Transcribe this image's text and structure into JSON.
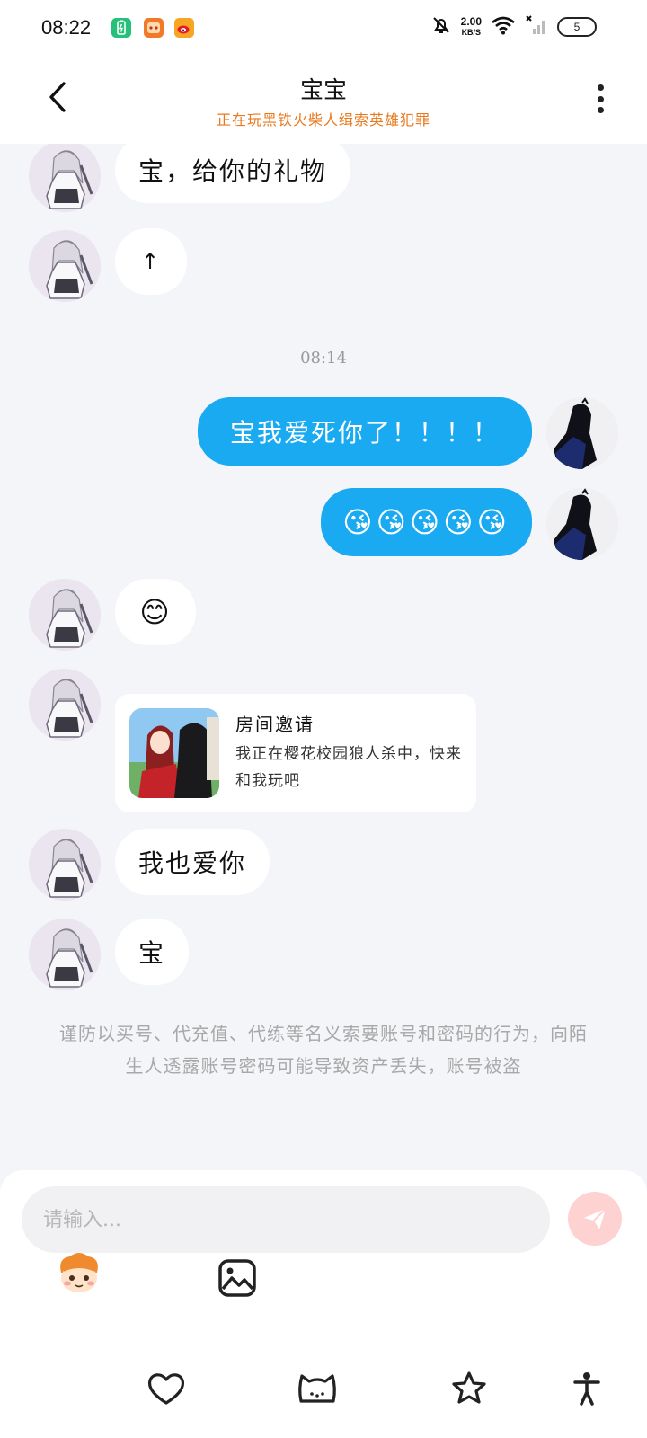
{
  "status_bar": {
    "time": "08:22",
    "net_speed_value": "2.00",
    "net_speed_unit": "KB/S",
    "battery": "5",
    "icons": [
      "battery-saver-app-icon",
      "game-app-icon",
      "weibo-app-icon",
      "mute-bell-icon",
      "wifi-icon",
      "cellular-icon",
      "battery-icon"
    ]
  },
  "header": {
    "title": "宝宝",
    "status": "正在玩黑铁火柴人缉索英雄犯罪"
  },
  "messages": [
    {
      "side": "other",
      "text": "宝，给你的礼物"
    },
    {
      "side": "other",
      "text": "↑"
    },
    {
      "side": "time",
      "text": "08:14"
    },
    {
      "side": "self",
      "text": "宝我爱死你了！！！！"
    },
    {
      "side": "self",
      "text": "😘😘😘😘😘"
    },
    {
      "side": "other",
      "text": "😊"
    },
    {
      "side": "other",
      "type": "invite",
      "title": "房间邀请",
      "desc": "我正在樱花校园狼人杀中，快来和我玩吧"
    },
    {
      "side": "other",
      "text": "我也爱你"
    },
    {
      "side": "other",
      "text": "宝"
    }
  ],
  "warning": "谨防以买号、代充值、代练等名义索要账号和密码的行为，向陌生人透露账号密码可能导致资产丢失，账号被盗",
  "input": {
    "placeholder": "请输入..."
  },
  "toolbar": {
    "icons": [
      "emoji-sticker-icon",
      "image-icon"
    ]
  },
  "bottom_nav": {
    "icons": [
      "heart-icon",
      "cat-face-icon",
      "star-icon",
      "accessibility-icon"
    ]
  },
  "colors": {
    "self_bubble": "#1aaaf2",
    "status_orange": "#e8791d",
    "send_button": "#ffd2d2"
  }
}
